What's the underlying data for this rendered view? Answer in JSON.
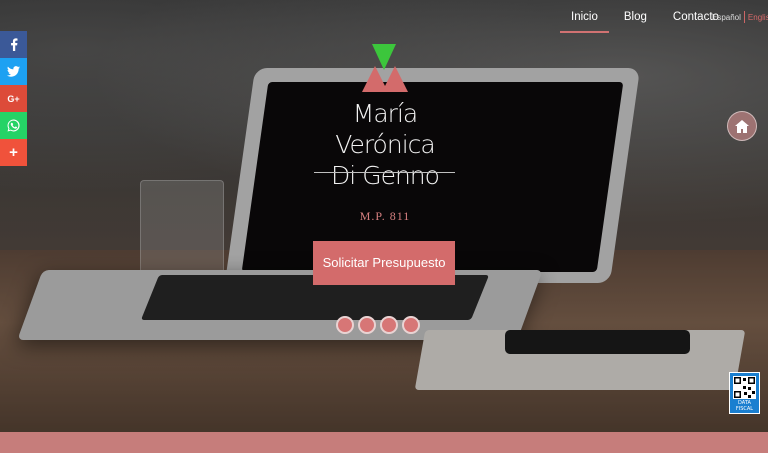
{
  "nav": {
    "items": [
      "Inicio",
      "Blog",
      "Contacto"
    ],
    "active_index": 0
  },
  "lang": {
    "es": "Español",
    "en": "English"
  },
  "social": [
    {
      "icon": "facebook-icon",
      "glyph": "f",
      "color": "#3b5998"
    },
    {
      "icon": "twitter-icon",
      "glyph": "t",
      "color": "#1da1f2"
    },
    {
      "icon": "google-plus-icon",
      "glyph": "G+",
      "color": "#dd4b39"
    },
    {
      "icon": "whatsapp-icon",
      "glyph": "w",
      "color": "#25d366"
    },
    {
      "icon": "share-plus-icon",
      "glyph": "+",
      "color": "#f0523b"
    }
  ],
  "hero": {
    "title_line1": "María Verónica",
    "title_line2": "Di Genno",
    "mp": "M.P. 811",
    "cta": "Solicitar Presupuesto",
    "slides": 4
  },
  "qr": {
    "label_line1": "DATA",
    "label_line2": "FISCAL"
  },
  "colors": {
    "accent": "#d36b6b",
    "logo_green": "#3cc63c",
    "bottom_bar": "#c67d7b"
  }
}
